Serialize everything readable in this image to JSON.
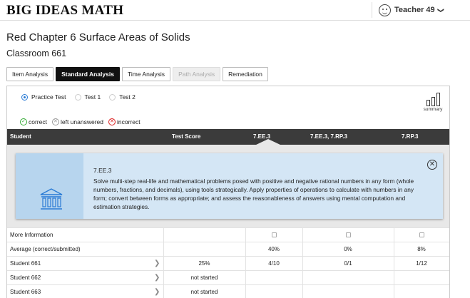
{
  "header": {
    "logo": "BIG IDEAS MATH",
    "user_name": "Teacher 49",
    "user_menu_chevron": "❯"
  },
  "page": {
    "title": "Red Chapter 6 Surface Areas of Solids",
    "classroom": "Classroom 661"
  },
  "tabs": [
    {
      "label": "Item Analysis",
      "state": "normal"
    },
    {
      "label": "Standard Analysis",
      "state": "active"
    },
    {
      "label": "Time Analysis",
      "state": "normal"
    },
    {
      "label": "Path Analysis",
      "state": "disabled"
    },
    {
      "label": "Remediation",
      "state": "normal"
    }
  ],
  "tests": [
    {
      "label": "Practice Test",
      "selected": true
    },
    {
      "label": "Test 1",
      "selected": false
    },
    {
      "label": "Test 2",
      "selected": false
    }
  ],
  "summary_label": "summary",
  "legend": {
    "correct": "correct",
    "unanswered": "left unanswered",
    "incorrect": "incorrect"
  },
  "table": {
    "headers": {
      "student": "Student",
      "score": "Test Score",
      "s1": "7.EE.3",
      "s2": "7.EE.3, 7.RP.3",
      "s3": "7.RP.3"
    },
    "more_info": "More Information",
    "average": {
      "label": "Average (correct/submitted)",
      "s1": "40%",
      "s2": "0%",
      "s3": "8%"
    },
    "students": [
      {
        "name": "Student 661",
        "score": "25%",
        "s1": "4/10",
        "s2": "0/1",
        "s3": "1/12"
      },
      {
        "name": "Student 662",
        "score": "not started",
        "s1": "",
        "s2": "",
        "s3": ""
      },
      {
        "name": "Student 663",
        "score": "not started",
        "s1": "",
        "s2": "",
        "s3": ""
      }
    ]
  },
  "popover": {
    "code": "7.EE.3",
    "text": "Solve multi-step real-life and mathematical problems posed with positive and negative rational numbers in any form (whole numbers, fractions, and decimals), using tools strategically. Apply properties of operations to calculate with numbers in any form; convert between forms as appropriate; and assess the reasonableness of answers using mental computation and estimation strategies.",
    "close_glyph": "✕"
  },
  "colors": {
    "header_bg": "#3b3b3b",
    "popover_bg": "#d4e6f5",
    "popover_icon_bg": "#b7d5ee",
    "accent_blue": "#2a7bd5",
    "correct_green": "#33aa33",
    "incorrect_red": "#dd2222"
  }
}
